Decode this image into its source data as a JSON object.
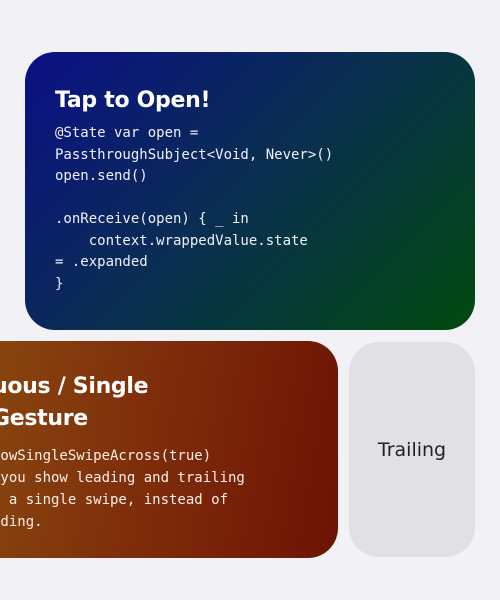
{
  "top_card": {
    "title": "Tap to Open!",
    "code": "@State var open =\nPassthroughSubject<Void, Never>()\nopen.send()\n\n.onReceive(open) { _ in\n    context.wrappedValue.state\n= .expanded\n}"
  },
  "left_card": {
    "title": "uous / Single\nGesture",
    "code": "lowSingleSwipeAcross(true)\n you show leading and trailing\nn a single swipe, instead of\nnding."
  },
  "right_card": {
    "label": "Trailing"
  },
  "colors": {
    "background": "#f2f2f6",
    "top_card_gradient": [
      "#0b0f86",
      "#004a0e"
    ],
    "left_card_gradient": [
      "#8a4a10",
      "#6d1304"
    ],
    "right_card": "#e0e0e5"
  }
}
